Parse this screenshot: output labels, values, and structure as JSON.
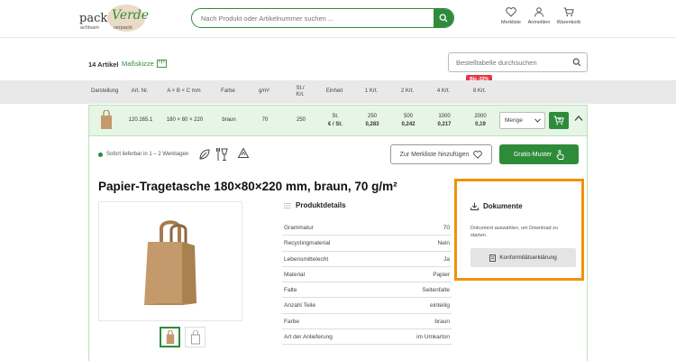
{
  "header": {
    "logo_main": "pack",
    "logo_brand": "Verde",
    "logo_sub_left": "achtsam",
    "logo_sub_right": "verpackt",
    "search_placeholder": "Nach Produkt oder Artikelnummer suchen ...",
    "nav": [
      {
        "label": "Merkliste",
        "icon": "heart-icon"
      },
      {
        "label": "Anmelden",
        "icon": "user-icon"
      },
      {
        "label": "Warenkorb",
        "icon": "cart-icon"
      }
    ]
  },
  "toolbar": {
    "count": "14 Artikel",
    "sketch_label": "Maßskizze",
    "order_search_placeholder": "Bestelltabelle durchsuchen"
  },
  "table": {
    "headers": [
      "Darstellung",
      "Art. Nr.",
      "A × B × C mm",
      "Farbe",
      "g/m²",
      "St./\nKrt.",
      "Einheit",
      "1 Krt.",
      "2 Krt.",
      "4 Krt.",
      "8 Krt."
    ],
    "discount_badge": "Bis -32%",
    "row": {
      "art_nr": "120.165.1",
      "dims": "180 × 80 × 220",
      "color": "braun",
      "gsm": "70",
      "per_carton": "250",
      "unit_top": "St.",
      "unit_bottom": "€ / St.",
      "tiers": [
        {
          "qty": "250",
          "price": "0,283"
        },
        {
          "qty": "500",
          "price": "0,242"
        },
        {
          "qty": "1000",
          "price": "0,217"
        },
        {
          "qty": "2000",
          "price": "0,19"
        }
      ],
      "qty_placeholder": "Menge"
    }
  },
  "detail": {
    "availability": "Sofort lieferbar in 1 – 2 Werktagen",
    "wishlist_button": "Zur Merkliste hinzufügen",
    "sample_button": "Gratis-Muster",
    "title": "Papier-Tragetasche 180×80×220 mm, braun, 70 g/m²",
    "details_title": "Produktdetails",
    "specs": [
      {
        "key": "Grammatur",
        "value": "70"
      },
      {
        "key": "Recyclingmaterial",
        "value": "Nein"
      },
      {
        "key": "Lebensmittelecht",
        "value": "Ja"
      },
      {
        "key": "Material",
        "value": "Papier"
      },
      {
        "key": "Falte",
        "value": "Seitenfalte"
      },
      {
        "key": "Anzahl Teile",
        "value": "einteilig"
      },
      {
        "key": "Farbe",
        "value": "braun"
      },
      {
        "key": "Art der Anlieferung",
        "value": "im Umkarton"
      }
    ]
  },
  "documents": {
    "title": "Dokumente",
    "text": "Dokument auswählen, um Download zu starten.",
    "button": "Konformitätserklärung"
  },
  "colors": {
    "brand_green": "#2e8b3a",
    "row_highlight": "#e6f5e6",
    "header_gray": "#e9e9e9",
    "docs_border": "#f0920a",
    "badge_red": "#e63946",
    "kraft_brown": "#c49a6c"
  }
}
